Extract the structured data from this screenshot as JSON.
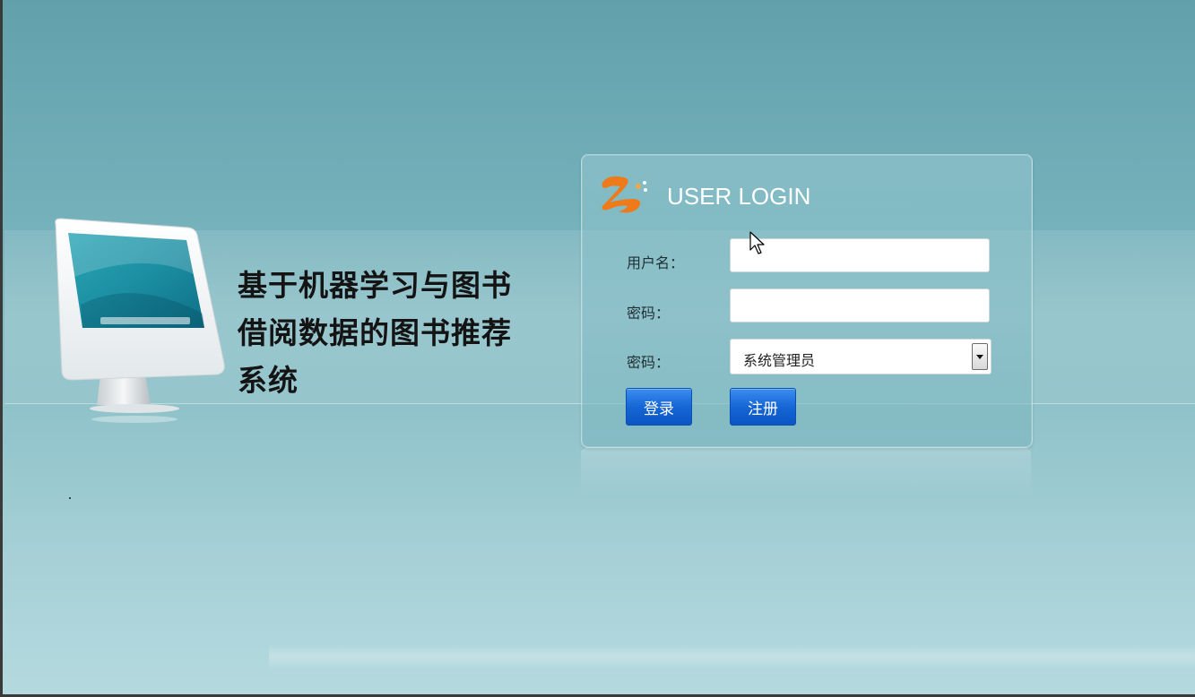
{
  "title_lines": [
    "基于机器学习与图书",
    "借阅数据的图书推荐",
    "系统"
  ],
  "login": {
    "heading": "USER LOGIN",
    "username_label": "用户名：",
    "username_value": "",
    "password_label": "密码：",
    "password_value": "",
    "role_label": "密码：",
    "role_selected": "系统管理员",
    "login_button": "登录",
    "register_button": "注册"
  },
  "colors": {
    "button_blue": "#1666d6",
    "logo_orange": "#ef7a1a",
    "heading_text": "#ffffff"
  },
  "icons": {
    "logo": "login-logo-icon",
    "monitor": "computer-monitor-icon",
    "select_arrow": "chevron-down-icon",
    "cursor": "mouse-pointer-icon"
  }
}
